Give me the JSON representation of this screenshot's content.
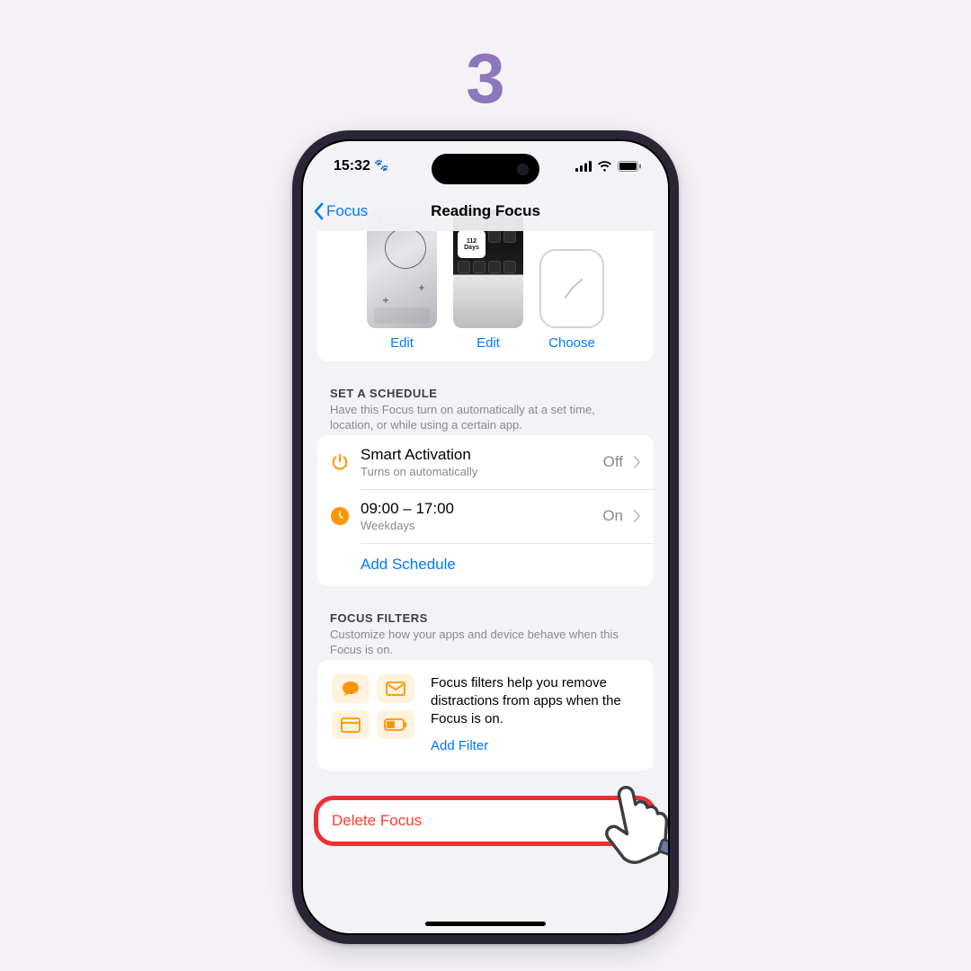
{
  "step_number": "3",
  "status": {
    "time": "15:32 ",
    "paw": "🐾"
  },
  "nav": {
    "back_label": "Focus",
    "title": "Reading Focus"
  },
  "screens": {
    "lock_label": "Edit",
    "home_label": "Edit",
    "watch_label": "Choose"
  },
  "schedule": {
    "header": "SET A SCHEDULE",
    "subtitle": "Have this Focus turn on automatically at a set time, location, or while using a certain app.",
    "rows": [
      {
        "title": "Smart Activation",
        "sub": "Turns on automatically",
        "value": "Off"
      },
      {
        "title": "09:00 – 17:00",
        "sub": "Weekdays",
        "value": "On"
      }
    ],
    "add_label": "Add Schedule"
  },
  "filters": {
    "header": "FOCUS FILTERS",
    "subtitle": "Customize how your apps and device behave when this Focus is on.",
    "description": "Focus filters help you remove distractions from apps when the Focus is on.",
    "add_label": "Add Filter"
  },
  "delete_label": "Delete Focus"
}
